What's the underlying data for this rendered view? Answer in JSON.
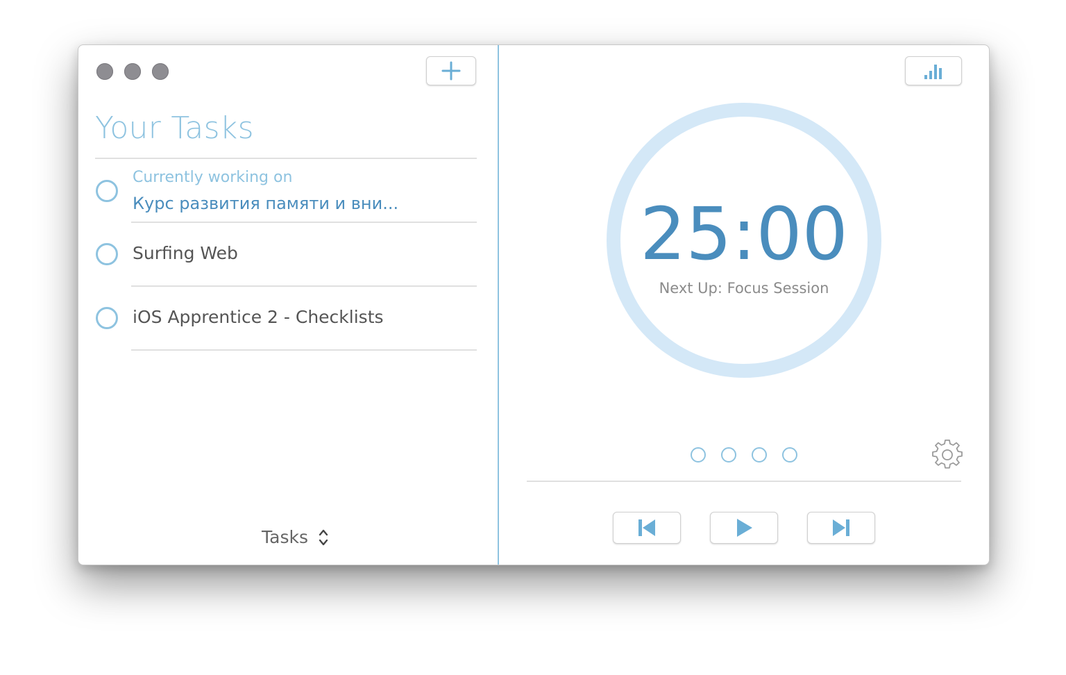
{
  "window": {
    "traffic_lights": [
      "close",
      "minimize",
      "zoom"
    ]
  },
  "toolbar": {
    "add_icon": "plus-icon",
    "stats_icon": "bar-chart-icon"
  },
  "tasks_panel": {
    "title": "Your Tasks",
    "current": {
      "subtitle": "Currently working on",
      "name": "Курс развития памяти и вни..."
    },
    "items": [
      {
        "label": "Surfing Web"
      },
      {
        "label": "iOS Apprentice 2 - Checklists"
      }
    ],
    "selector_label": "Tasks"
  },
  "timer": {
    "value": "25:00",
    "next_up": "Next Up: Focus Session",
    "sessions_completed": 0,
    "sessions_total": 4
  },
  "controls": {
    "prev_icon": "skip-back-icon",
    "play_icon": "play-icon",
    "next_icon": "skip-forward-icon",
    "settings_icon": "gear-icon"
  },
  "colors": {
    "accent": "#8ec3e0",
    "accent_dark": "#4a8dbd",
    "ring": "#d4e8f7",
    "traffic_light": "#8e8d92"
  }
}
